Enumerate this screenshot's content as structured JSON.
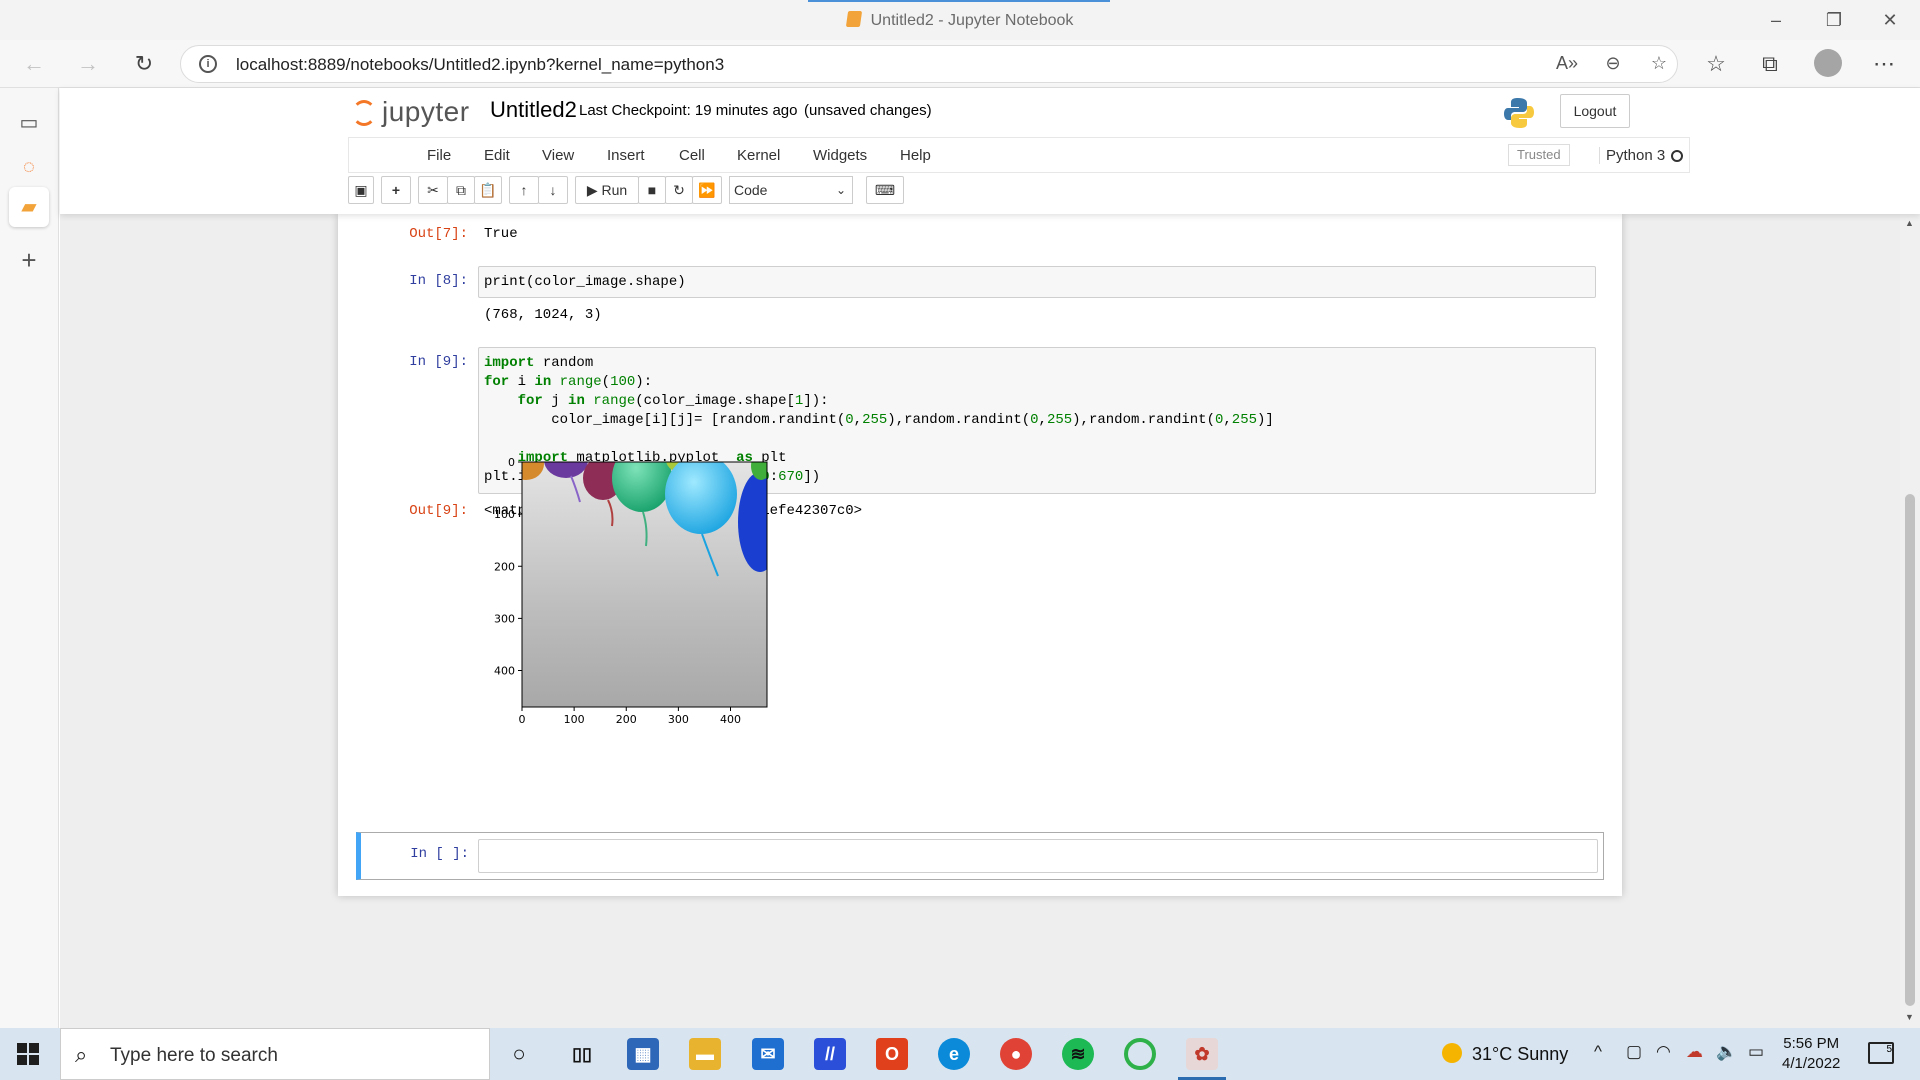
{
  "browser": {
    "tab_title": "Untitled2 - Jupyter Notebook",
    "url": "localhost:8889/notebooks/Untitled2.ipynb?kernel_name=python3"
  },
  "jupyter": {
    "logo_text": "jupyter",
    "notebook_name": "Untitled2",
    "checkpoint": "Last Checkpoint: 19 minutes ago",
    "unsaved": "(unsaved changes)",
    "logout_label": "Logout",
    "menu": [
      "File",
      "Edit",
      "View",
      "Insert",
      "Cell",
      "Kernel",
      "Widgets",
      "Help"
    ],
    "trusted_label": "Trusted",
    "kernel_name": "Python 3",
    "run_label": "Run",
    "cell_type": "Code"
  },
  "cells": {
    "out7_prompt": "Out[7]:",
    "out7_value": "True",
    "in8_prompt": "In [8]:",
    "in8_code": "print(color_image.shape)",
    "out8_value": "(768, 1024, 3)",
    "in9_prompt": "In [9]:",
    "out9_prompt": "Out[9]:",
    "out9_value": "<matplotlib.image.AxesImage at 0x1efe42307c0>",
    "new_prompt": "In [ ]:"
  },
  "chart_data": {
    "type": "image",
    "xticks": [
      "0",
      "100",
      "200",
      "300",
      "400"
    ],
    "yticks": [
      "0",
      "100",
      "200",
      "300",
      "400"
    ],
    "xlim": [
      0,
      470
    ],
    "ylim": [
      470,
      0
    ]
  },
  "taskbar": {
    "search_placeholder": "Type here to search",
    "weather": "31°C  Sunny",
    "time": "5:56 PM",
    "date": "4/1/2022",
    "notification_count": "5"
  },
  "colors": {
    "accent": "#42a5f5",
    "in_prompt": "#303f9f",
    "out_prompt": "#d84315",
    "jupyter_orange": "#f37726"
  }
}
